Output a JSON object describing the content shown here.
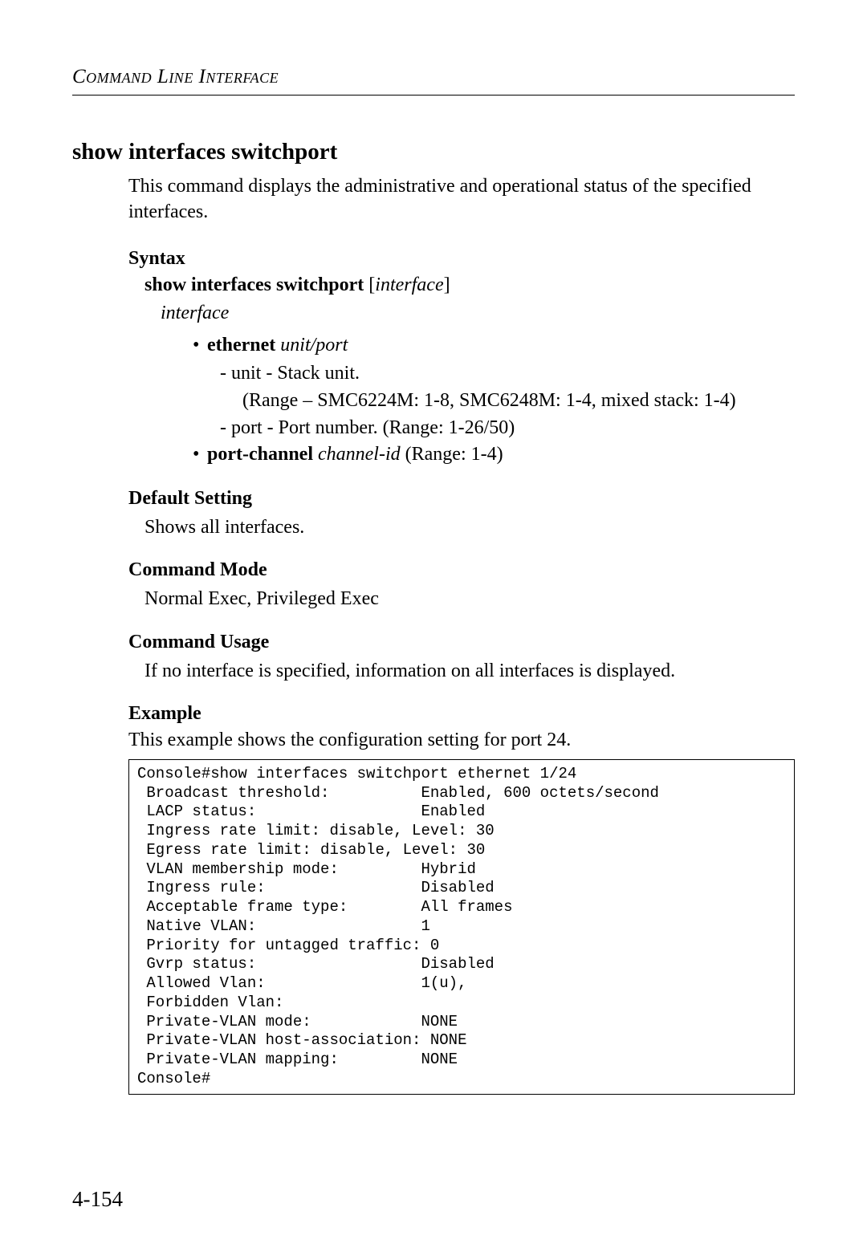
{
  "header": "Command Line Interface",
  "title": "show interfaces switchport",
  "description": "This command displays the administrative and operational status of the specified interfaces.",
  "syntax": {
    "heading": "Syntax",
    "command": "show interfaces switchport",
    "arg": "interface",
    "interface_label": "interface",
    "ethernet_label": "ethernet",
    "ethernet_arg": "unit/port",
    "unit_line": "unit - Stack unit.",
    "unit_range": "(Range – SMC6224M: 1-8, SMC6248M: 1-4, mixed stack: 1-4)",
    "port_line": "port - Port number. (Range: 1-26/50)",
    "portchannel_label": "port-channel",
    "portchannel_arg": "channel-id",
    "portchannel_range": " (Range: 1-4)"
  },
  "default_setting": {
    "heading": "Default Setting",
    "text": "Shows all interfaces."
  },
  "command_mode": {
    "heading": "Command Mode",
    "text": "Normal Exec, Privileged Exec"
  },
  "command_usage": {
    "heading": "Command Usage",
    "text": "If no interface is specified, information on all interfaces is displayed."
  },
  "example": {
    "heading": "Example",
    "intro": "This example shows the configuration setting for port 24.",
    "console": "Console#show interfaces switchport ethernet 1/24\n Broadcast threshold:          Enabled, 600 octets/second\n LACP status:                  Enabled\n Ingress rate limit: disable, Level: 30\n Egress rate limit: disable, Level: 30\n VLAN membership mode:         Hybrid\n Ingress rule:                 Disabled\n Acceptable frame type:        All frames\n Native VLAN:                  1\n Priority for untagged traffic: 0\n Gvrp status:                  Disabled\n Allowed Vlan:                 1(u),\n Forbidden Vlan:\n Private-VLAN mode:            NONE\n Private-VLAN host-association: NONE\n Private-VLAN mapping:         NONE\nConsole#"
  },
  "page_number": "4-154"
}
